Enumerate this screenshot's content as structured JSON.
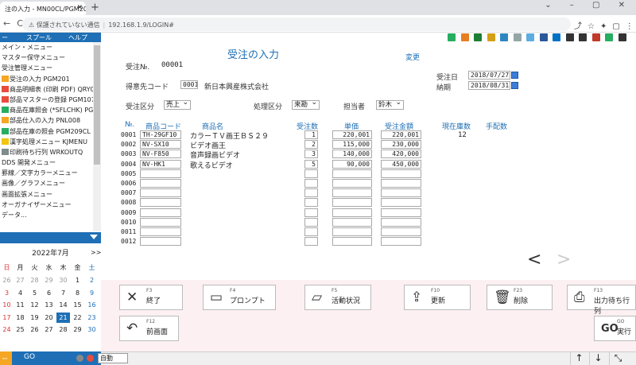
{
  "browser": {
    "tab_title": "注の入力 - MN00CL/PGM201",
    "security": "保護されていない通信",
    "url": "192.168.1.9/LOGIN#"
  },
  "menubar": {
    "left": "ー",
    "spool": "スプール",
    "help": "ヘルプ"
  },
  "menu": [
    {
      "label": "メイン・メニュー",
      "icon": ""
    },
    {
      "label": "マスター保守メニュー",
      "icon": ""
    },
    {
      "label": "受注管理メニュー",
      "icon": ""
    },
    {
      "label": "受注の入力 PGM201",
      "icon": "#f5a623"
    },
    {
      "label": "商品明細表 (印刷 PDF) QRY00",
      "icon": "#e74c3c"
    },
    {
      "label": "部品マスターの登録 PGM107",
      "icon": "#e74c3c"
    },
    {
      "label": "商品在庫照会 (*SFLCHK) PGM2",
      "icon": "#27ae60"
    },
    {
      "label": "部品仕入の入力 PNL008",
      "icon": "#f5a623"
    },
    {
      "label": "部品在庫の照会 PGM209CL",
      "icon": "#27ae60"
    },
    {
      "label": "漢字処理メニュー KJMENU",
      "icon": "#f1c40f"
    },
    {
      "label": "印刷待ち行列 WRKOUTQ",
      "icon": "#7f8c8d"
    },
    {
      "label": "DDS 開発メニュー",
      "icon": ""
    },
    {
      "label": "罫線／文字カラーメニュー",
      "icon": ""
    },
    {
      "label": "画像／グラフメニュー",
      "icon": ""
    },
    {
      "label": "画面拡張メニュー",
      "icon": ""
    },
    {
      "label": "オーガナイザーメニュー",
      "icon": ""
    },
    {
      "label": "データ...",
      "icon": ""
    }
  ],
  "calendar": {
    "month": "2022年7月",
    "next": ">>",
    "dow": [
      "日",
      "月",
      "火",
      "水",
      "木",
      "金",
      "土"
    ],
    "weeks": [
      [
        "26",
        "27",
        "28",
        "29",
        "30",
        "1",
        "2"
      ],
      [
        "3",
        "4",
        "5",
        "6",
        "7",
        "8",
        "9"
      ],
      [
        "10",
        "11",
        "12",
        "13",
        "14",
        "15",
        "16"
      ],
      [
        "17",
        "18",
        "19",
        "20",
        "21",
        "22",
        "23"
      ],
      [
        "24",
        "25",
        "26",
        "27",
        "28",
        "29",
        "30"
      ]
    ],
    "today": "21"
  },
  "form": {
    "title": "受注の入力",
    "change": "変更",
    "order_no_label": "受注№.",
    "order_no": "00001",
    "customer_label": "得意先コード",
    "customer_code": "0001",
    "customer_name": "新日本興産株式会社",
    "order_date_label": "受注日",
    "order_date": "2018/07/27",
    "delivery_label": "納期",
    "delivery_date": "2018/08/31",
    "order_type_label": "受注区分",
    "order_type": "売上",
    "proc_type_label": "処理区分",
    "proc_type": "来勘",
    "staff_label": "担当者",
    "staff": "鈴木",
    "col_no": "№.",
    "col_code": "商品コード",
    "col_name": "商品名",
    "col_qty": "受注数",
    "col_price": "単価",
    "col_amount": "受注金額",
    "col_stock": "現在庫数",
    "col_alloc": "手配数",
    "rows": [
      {
        "no": "0001",
        "code": "TH-29GF10",
        "name": "カラーＴＶ画王ＢＳ２９",
        "qty": "1",
        "price": "220,001",
        "amount": "220,001",
        "stock": "12"
      },
      {
        "no": "0002",
        "code": "NV-SX10",
        "name": "ビデオ画王",
        "qty": "2",
        "price": "115,000",
        "amount": "230,000",
        "stock": ""
      },
      {
        "no": "0003",
        "code": "NV-F850",
        "name": "音声録画ビデオ",
        "qty": "3",
        "price": "140,000",
        "amount": "420,000",
        "stock": ""
      },
      {
        "no": "0004",
        "code": "NV-HK1",
        "name": "歌えるビデオ",
        "qty": "5",
        "price": "90,000",
        "amount": "450,000",
        "stock": ""
      },
      {
        "no": "0005",
        "code": "",
        "name": "",
        "qty": "",
        "price": "",
        "amount": "",
        "stock": ""
      },
      {
        "no": "0006",
        "code": "",
        "name": "",
        "qty": "",
        "price": "",
        "amount": "",
        "stock": ""
      },
      {
        "no": "0007",
        "code": "",
        "name": "",
        "qty": "",
        "price": "",
        "amount": "",
        "stock": ""
      },
      {
        "no": "0008",
        "code": "",
        "name": "",
        "qty": "",
        "price": "",
        "amount": "",
        "stock": ""
      },
      {
        "no": "0009",
        "code": "",
        "name": "",
        "qty": "",
        "price": "",
        "amount": "",
        "stock": ""
      },
      {
        "no": "0010",
        "code": "",
        "name": "",
        "qty": "",
        "price": "",
        "amount": "",
        "stock": ""
      },
      {
        "no": "0011",
        "code": "",
        "name": "",
        "qty": "",
        "price": "",
        "amount": "",
        "stock": ""
      },
      {
        "no": "0012",
        "code": "",
        "name": "",
        "qty": "",
        "price": "",
        "amount": "",
        "stock": ""
      }
    ]
  },
  "toolbar_icons": [
    "download-icon",
    "upload-icon",
    "excel-icon",
    "image-icon",
    "chart-icon",
    "cloud-icon",
    "copy-icon",
    "word-icon",
    "outlook-icon",
    "camera-icon",
    "printer-icon",
    "pdf-icon",
    "csv-icon",
    "spool-icon"
  ],
  "fkeys": [
    {
      "key": "F3",
      "label": "終了",
      "glyph": "✕"
    },
    {
      "key": "F4",
      "label": "プロンプト",
      "glyph": "▭"
    },
    {
      "key": "F5",
      "label": "活動状況",
      "glyph": "▱"
    },
    {
      "key": "F10",
      "label": "更新",
      "glyph": "⇪"
    },
    {
      "key": "F23",
      "label": "削除",
      "glyph": "🗑"
    },
    {
      "key": "F13",
      "label": "出力待ち行列",
      "glyph": "⎙"
    },
    {
      "key": "F12",
      "label": "前画面",
      "glyph": "↶"
    },
    {
      "key": "GO",
      "label": "実行",
      "glyph": "GO"
    }
  ],
  "status": {
    "left": "ー",
    "go": "GO",
    "mode": "自動"
  }
}
